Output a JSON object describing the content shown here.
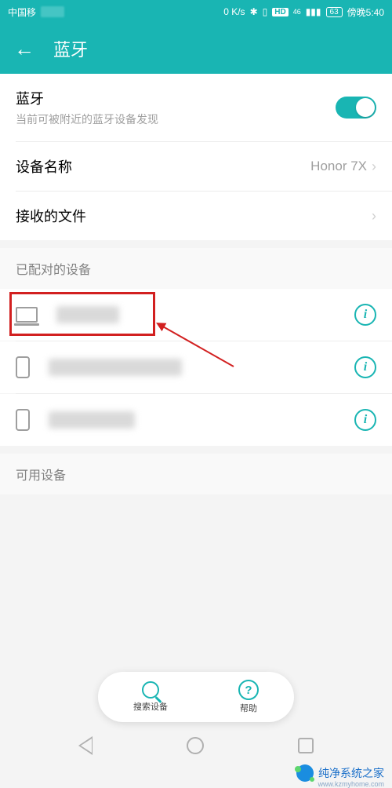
{
  "status_bar": {
    "carrier": "中国移",
    "speed": "0 K/s",
    "hd": "HD",
    "network": "46",
    "battery": "63",
    "time": "傍晚5:40"
  },
  "header": {
    "title": "蓝牙"
  },
  "bluetooth": {
    "label": "蓝牙",
    "subtitle": "当前可被附近的蓝牙设备发现",
    "enabled": true
  },
  "device_name_row": {
    "label": "设备名称",
    "value": "Honor 7X"
  },
  "received_files": {
    "label": "接收的文件"
  },
  "sections": {
    "paired": "已配对的设备",
    "available": "可用设备"
  },
  "pill": {
    "search": "搜索设备",
    "help": "帮助",
    "help_glyph": "?"
  },
  "watermark": {
    "text": "纯净系统之家",
    "url": "www.kzmyhome.com"
  },
  "info_glyph": "i"
}
